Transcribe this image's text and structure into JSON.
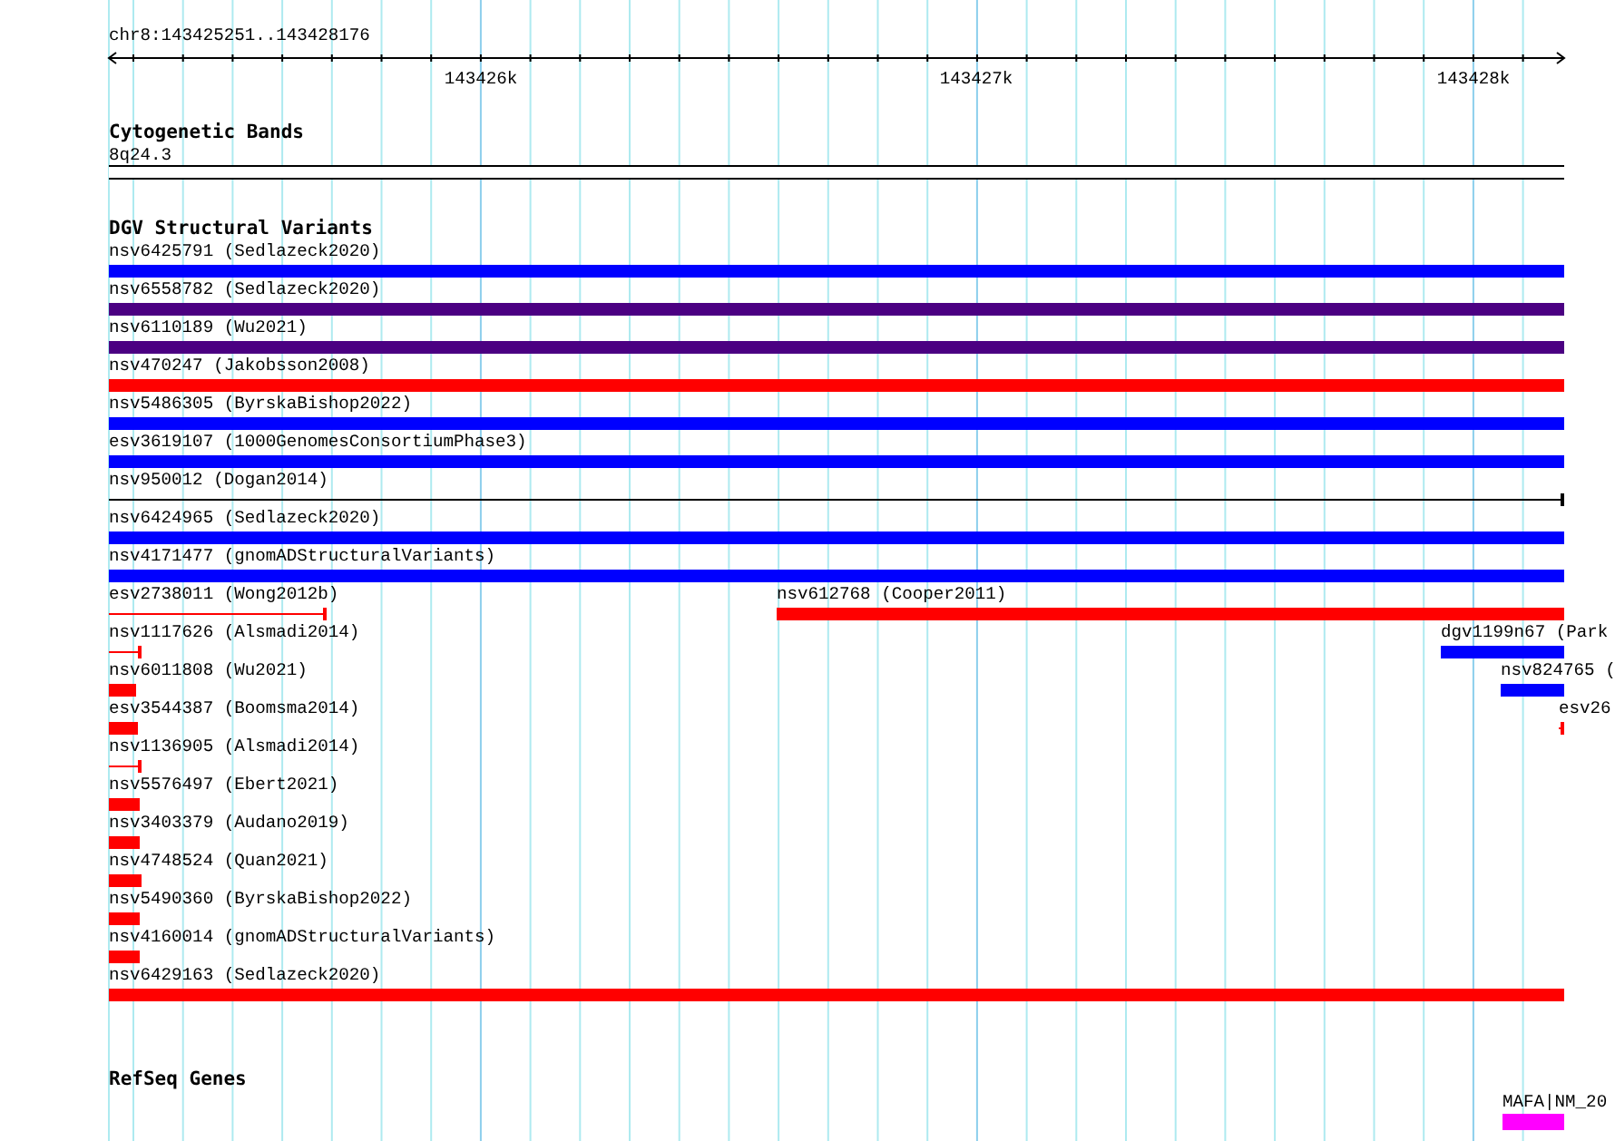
{
  "location": "chr8:143425251..143428176",
  "ruler": {
    "ticks": [
      "143426k",
      "143427k",
      "143428k"
    ]
  },
  "tracks": [
    {
      "kind": "bands",
      "title": "Cytogenetic Bands",
      "band": "8q24.3"
    },
    {
      "kind": "variants",
      "title": "DGV Structural Variants",
      "rows": [
        {
          "features": [
            {
              "label": "nsv6425791 (Sedlazeck2020)",
              "kind": "bar",
              "color": "#0000ff"
            }
          ]
        },
        {
          "features": [
            {
              "label": "nsv6558782 (Sedlazeck2020)",
              "kind": "bar",
              "color": "#4b0082"
            }
          ]
        },
        {
          "features": [
            {
              "label": "nsv6110189 (Wu2021)",
              "kind": "bar",
              "color": "#4b0082"
            }
          ]
        },
        {
          "features": [
            {
              "label": "nsv470247 (Jakobsson2008)",
              "kind": "bar",
              "color": "#ff0000"
            }
          ]
        },
        {
          "features": [
            {
              "label": "nsv5486305 (ByrskaBishop2022)",
              "kind": "bar",
              "color": "#0000ff"
            }
          ]
        },
        {
          "features": [
            {
              "label": "esv3619107 (1000GenomesConsortiumPhase3)",
              "kind": "bar",
              "color": "#0000ff"
            }
          ]
        },
        {
          "features": [
            {
              "label": "nsv950012 (Dogan2014)",
              "kind": "line",
              "color": "#000000"
            }
          ]
        },
        {
          "features": [
            {
              "label": "nsv6424965 (Sedlazeck2020)",
              "kind": "bar",
              "color": "#0000ff"
            }
          ]
        },
        {
          "features": [
            {
              "label": "nsv4171477 (gnomADStructuralVariants)",
              "kind": "bar",
              "color": "#0000ff"
            }
          ]
        },
        {
          "features": [
            {
              "label": "esv2738011 (Wong2012b)",
              "kind": "line",
              "color": "#ff0000"
            },
            {
              "label": "nsv612768 (Cooper2011)",
              "kind": "bar",
              "color": "#ff0000"
            }
          ]
        },
        {
          "features": [
            {
              "label": "nsv1117626 (Alsmadi2014)",
              "kind": "line",
              "color": "#ff0000"
            },
            {
              "label": "dgv1199n67 (Park",
              "kind": "bar",
              "color": "#0000ff"
            }
          ]
        },
        {
          "features": [
            {
              "label": "nsv6011808 (Wu2021)",
              "kind": "bar",
              "color": "#ff0000"
            },
            {
              "label": "nsv824765 (",
              "kind": "bar",
              "color": "#0000ff"
            }
          ]
        },
        {
          "features": [
            {
              "label": "esv3544387 (Boomsma2014)",
              "kind": "bar",
              "color": "#ff0000"
            },
            {
              "label": "esv26",
              "kind": "line",
              "color": "#ff0000"
            }
          ]
        },
        {
          "features": [
            {
              "label": "nsv1136905 (Alsmadi2014)",
              "kind": "line",
              "color": "#ff0000"
            }
          ]
        },
        {
          "features": [
            {
              "label": "nsv5576497 (Ebert2021)",
              "kind": "bar",
              "color": "#ff0000"
            }
          ]
        },
        {
          "features": [
            {
              "label": "nsv3403379 (Audano2019)",
              "kind": "bar",
              "color": "#ff0000"
            }
          ]
        },
        {
          "features": [
            {
              "label": "nsv4748524 (Quan2021)",
              "kind": "bar",
              "color": "#ff0000"
            }
          ]
        },
        {
          "features": [
            {
              "label": "nsv5490360 (ByrskaBishop2022)",
              "kind": "bar",
              "color": "#ff0000"
            }
          ]
        },
        {
          "features": [
            {
              "label": "nsv4160014 (gnomADStructuralVariants)",
              "kind": "bar",
              "color": "#ff0000"
            }
          ]
        },
        {
          "features": [
            {
              "label": "nsv6429163 (Sedlazeck2020)",
              "kind": "bar",
              "color": "#ff0000"
            }
          ]
        }
      ]
    },
    {
      "kind": "genes",
      "title": "RefSeq Genes",
      "features": [
        {
          "label": "MAFA|NM_20",
          "color": "#ff00ff"
        }
      ]
    }
  ]
}
